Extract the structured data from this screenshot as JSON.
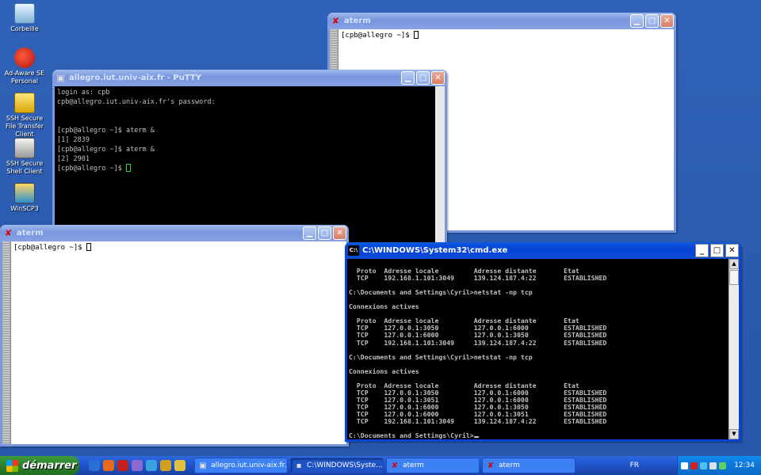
{
  "desktop": {
    "icons": [
      {
        "label": "Corbeille",
        "icon": "recycle-bin-icon"
      },
      {
        "label": "Ad-Aware SE Personal",
        "icon": "ad-aware-icon"
      },
      {
        "label": "SSH Secure File Transfer Client",
        "icon": "ssh-file-transfer-icon"
      },
      {
        "label": "SSH Secure Shell Client",
        "icon": "ssh-shell-icon"
      },
      {
        "label": "WinSCP3",
        "icon": "winscp-icon"
      }
    ]
  },
  "aterm_top": {
    "title": "aterm",
    "prompt": "[cpb@allegro ~]$ "
  },
  "putty": {
    "title": "allegro.iut.univ-aix.fr - PuTTY",
    "lines": [
      "login as: cpb",
      "cpb@allegro.iut.univ-aix.fr's password:",
      "",
      "",
      "[cpb@allegro ~]$ aterm &",
      "[1] 2839",
      "[cpb@allegro ~]$ aterm &",
      "[2] 2901",
      "[cpb@allegro ~]$ "
    ]
  },
  "aterm_bottom": {
    "title": "aterm",
    "prompt": "[cpb@allegro ~]$ "
  },
  "cmd": {
    "title": "C:\\WINDOWS\\System32\\cmd.exe",
    "lines": [
      "",
      "  Proto  Adresse locale         Adresse distante       Etat",
      "  TCP    192.168.1.101:3049     139.124.187.4:22       ESTABLISHED",
      "",
      "C:\\Documents and Settings\\Cyril>netstat -np tcp",
      "",
      "Connexions actives",
      "",
      "  Proto  Adresse locale         Adresse distante       Etat",
      "  TCP    127.0.0.1:3050         127.0.0.1:6000         ESTABLISHED",
      "  TCP    127.0.0.1:6000         127.0.0.1:3050         ESTABLISHED",
      "  TCP    192.168.1.101:3049     139.124.187.4:22       ESTABLISHED",
      "",
      "C:\\Documents and Settings\\Cyril>netstat -np tcp",
      "",
      "Connexions actives",
      "",
      "  Proto  Adresse locale         Adresse distante       Etat",
      "  TCP    127.0.0.1:3050         127.0.0.1:6000         ESTABLISHED",
      "  TCP    127.0.0.1:3051         127.0.0.1:6000         ESTABLISHED",
      "  TCP    127.0.0.1:6000         127.0.0.1:3050         ESTABLISHED",
      "  TCP    127.0.0.1:6000         127.0.0.1:3051         ESTABLISHED",
      "  TCP    192.168.1.101:3049     139.124.187.4:22       ESTABLISHED",
      ""
    ],
    "prompt": "C:\\Documents and Settings\\Cyril>"
  },
  "taskbar": {
    "start_label": "démarrer",
    "tasks": [
      {
        "label": "allegro.iut.univ-aix.fr...",
        "icon": "putty-icon",
        "active": false
      },
      {
        "label": "C:\\WINDOWS\\Syste...",
        "icon": "cmd-icon",
        "active": true
      },
      {
        "label": "aterm",
        "icon": "aterm-icon",
        "active": false
      },
      {
        "label": "aterm",
        "icon": "aterm-icon",
        "active": false
      }
    ],
    "language": "FR",
    "clock": "12:34"
  },
  "colors": {
    "desktop": "#2f62b8",
    "titlebar_active": "#0842d6",
    "start_button": "#3c9a3c"
  }
}
